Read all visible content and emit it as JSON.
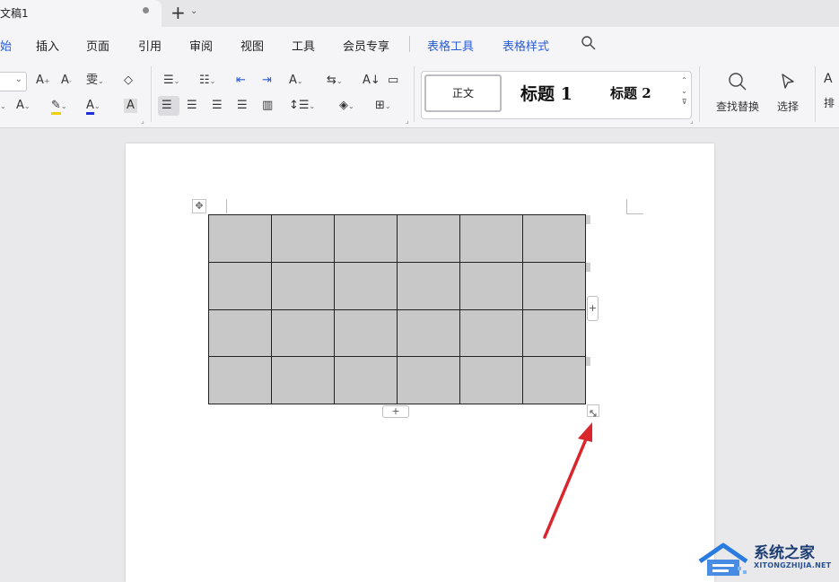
{
  "titlebar": {
    "doc_tab_title": "文稿1"
  },
  "menu": {
    "tabs": [
      {
        "label": "始"
      },
      {
        "label": "插入"
      },
      {
        "label": "页面"
      },
      {
        "label": "引用"
      },
      {
        "label": "审阅"
      },
      {
        "label": "视图"
      },
      {
        "label": "工具"
      },
      {
        "label": "会员专享"
      },
      {
        "label": "表格工具"
      },
      {
        "label": "表格样式"
      }
    ],
    "active_tab": "始"
  },
  "ribbon": {
    "styles": {
      "normal": "正文",
      "heading1": "标题 1",
      "heading2": "标题 2"
    },
    "find_replace_label": "查找替换",
    "select_label": "选择",
    "sort_partial_label": "排"
  },
  "table": {
    "rows": 4,
    "columns": 6,
    "add_button": "+"
  },
  "watermark": {
    "name": "系统之家",
    "url": "XITONGZHIJIA.NET"
  },
  "colors": {
    "accent": "#2a5bd7",
    "table_fill": "#c8c8c8",
    "arrow": "#d9262c",
    "highlight_yellow": "#f5d000",
    "font_color_blue": "#1f2fd6"
  }
}
